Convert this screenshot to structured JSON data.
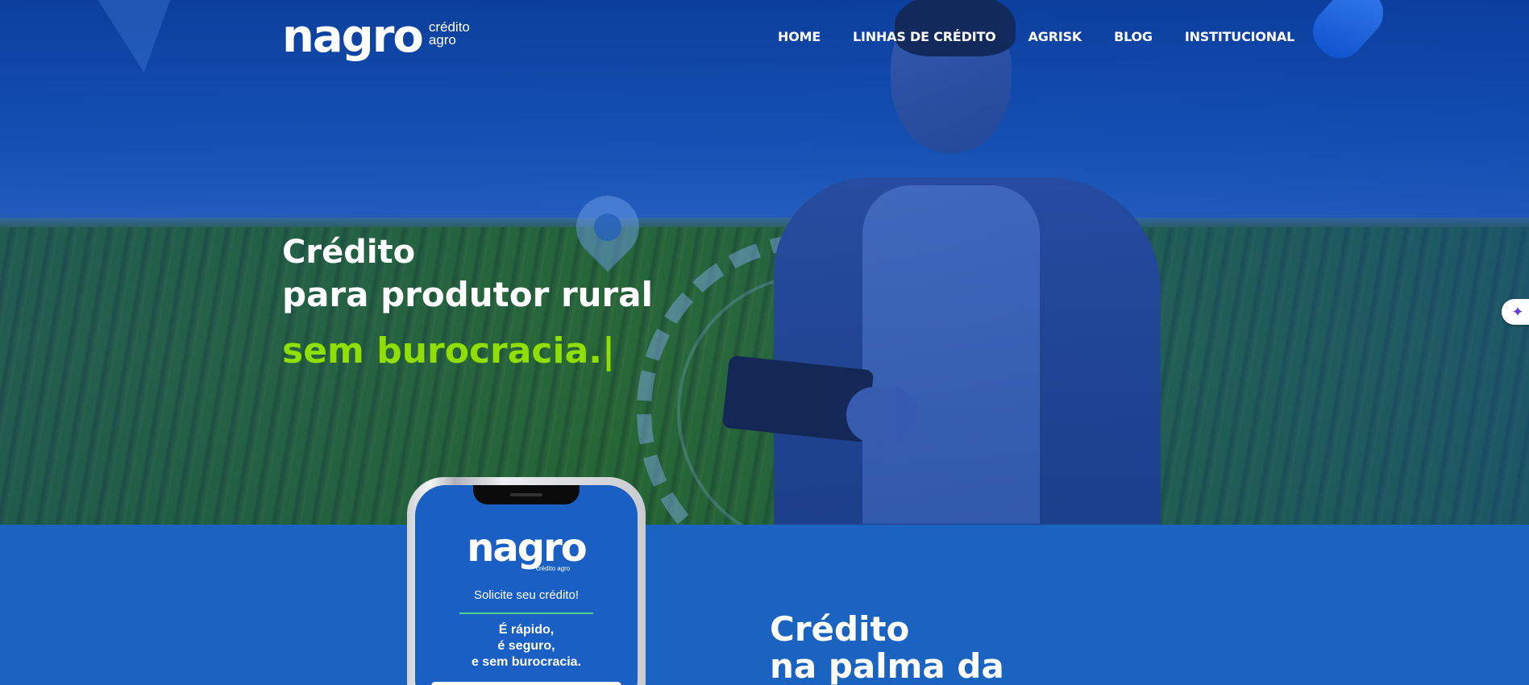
{
  "brand": {
    "name": "nagro",
    "sub_line1": "crédito",
    "sub_line2": "agro",
    "accent_green": "#8fe000",
    "primary_blue": "#1a63c0"
  },
  "nav": {
    "items": [
      "HOME",
      "LINHAS DE CRÉDITO",
      "AGRISK",
      "BLOG",
      "INSTITUCIONAL"
    ]
  },
  "hero": {
    "line1": "Crédito",
    "line2": "para produtor rural",
    "line3": "sem burocracia.|"
  },
  "assistant": {
    "icon": "sparkle-icon"
  },
  "phone": {
    "logo": "nagro",
    "logo_sub": "crédito agro",
    "cta": "Solicite seu crédito!",
    "text_line1": "É rápido,",
    "text_line2": "é seguro,",
    "text_line3": "e sem burocracia."
  },
  "section": {
    "title_line1": "Crédito",
    "title_line2": "na palma da"
  }
}
